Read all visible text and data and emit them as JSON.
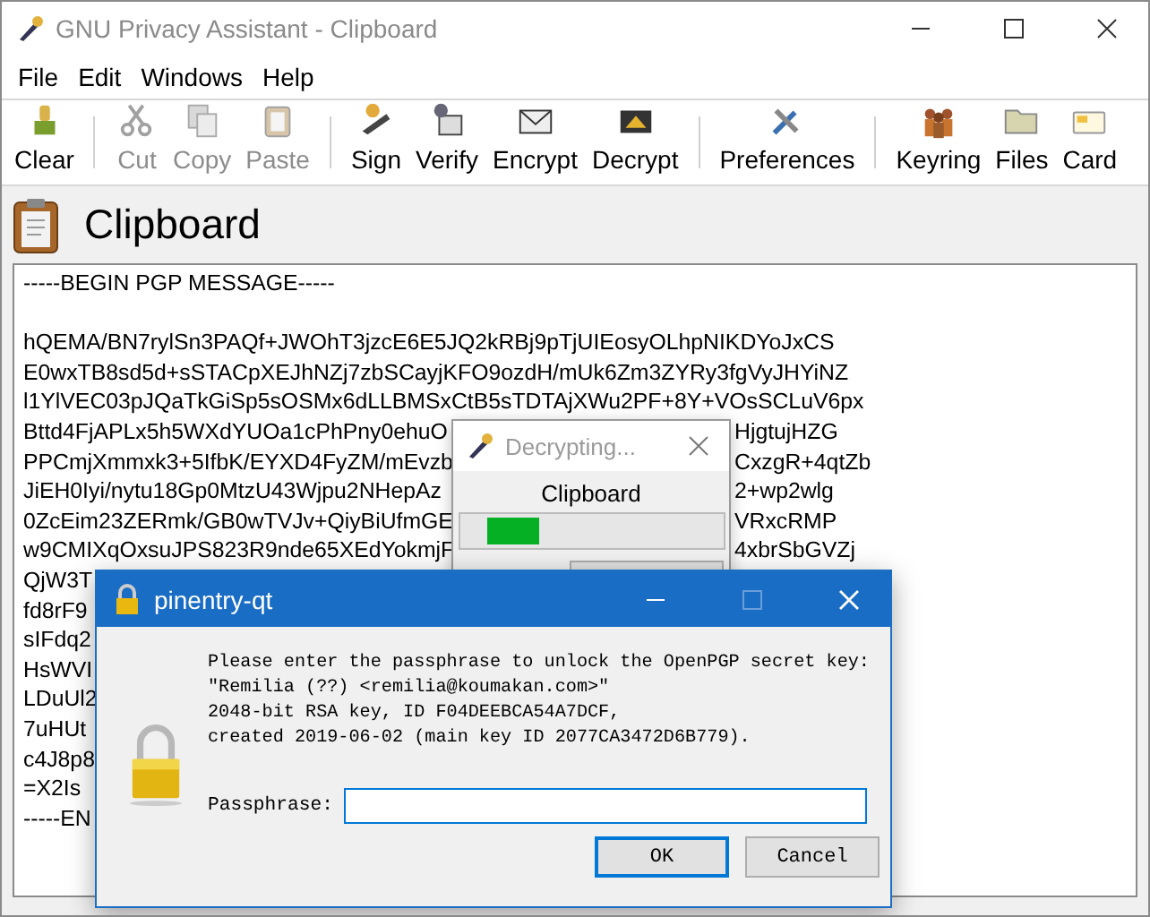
{
  "window": {
    "title": "GNU Privacy Assistant - Clipboard",
    "active": false
  },
  "menu": [
    {
      "label": "File"
    },
    {
      "label": "Edit"
    },
    {
      "label": "Windows"
    },
    {
      "label": "Help"
    }
  ],
  "toolbar": [
    [
      {
        "label": "Clear",
        "disabled": false
      }
    ],
    [
      {
        "label": "Cut",
        "disabled": true
      },
      {
        "label": "Copy",
        "disabled": true
      },
      {
        "label": "Paste",
        "disabled": true
      }
    ],
    [
      {
        "label": "Sign",
        "disabled": false
      },
      {
        "label": "Verify",
        "disabled": false
      },
      {
        "label": "Encrypt",
        "disabled": false
      },
      {
        "label": "Decrypt",
        "disabled": false
      }
    ],
    [
      {
        "label": "Preferences",
        "disabled": false
      }
    ],
    [
      {
        "label": "Keyring",
        "disabled": false
      },
      {
        "label": "Files",
        "disabled": false
      },
      {
        "label": "Card",
        "disabled": false
      }
    ]
  ],
  "header": {
    "title": "Clipboard"
  },
  "message_lines": [
    {
      "left": "-----BEGIN PGP MESSAGE-----"
    },
    {
      "kind": "blank"
    },
    {
      "left": "hQEMA/BN7rylSn3PAQf+JWOhT3jzcE6E5JQ2kRBj9pTjUIEosyOLhpNIKDYoJxCS"
    },
    {
      "left": "E0wxTB8sd5d+sSTACpXEJhNZj7zbSCayjKFO9ozdH/mUk6Zm3ZYRy3fgVyJHYiNZ"
    },
    {
      "left": "l1YlVEC03pJQaTkGiSp5sOSMx6dLLBMSxCtB5sTDTAjXWu2PF+8Y+VOsSCLuV6px"
    },
    {
      "left": "Bttd4FjAPLx5h5WXdYUOa1cPhPny0ehuO",
      "right": "HjgtujHZG"
    },
    {
      "left": "PPCmjXmmxk3+5IfbK/EYXD4FyZM/mEvzb",
      "right": "CxzgR+4qtZb"
    },
    {
      "left": "JiEH0Iyi/nytu18Gp0MtzU43Wjpu2NHepAz",
      "right": "2+wp2wlg"
    },
    {
      "left": "0ZcEim23ZERmk/GB0wTVJv+QiyBiUfmGE",
      "right": "VRxcRMP"
    },
    {
      "left": "w9CMIXqOxsuJPS823R9nde65XEdYokmjF",
      "right": "4xbrSbGVZj"
    },
    {
      "left": "QjW3T"
    },
    {
      "left": "fd8rF9"
    },
    {
      "left": "sIFdq2"
    },
    {
      "left": "HsWVI"
    },
    {
      "left": "LDuUl2"
    },
    {
      "left": "7uHUt"
    },
    {
      "left": "c4J8p8"
    },
    {
      "left": "=X2Is"
    },
    {
      "left": "-----EN"
    }
  ],
  "progress_dialog": {
    "title": "Decrypting...",
    "label": "Clipboard",
    "level": 0.2
  },
  "pinentry": {
    "title": "pinentry-qt",
    "message": [
      "Please enter the passphrase to unlock the OpenPGP secret key:",
      "\"Remilia (??) <remilia@koumakan.com>\"",
      "2048-bit RSA key, ID F04DEEBCA54A7DCF,",
      "created 2019-06-02 (main key ID 2077CA3472D6B779)."
    ],
    "field_label": "Passphrase:",
    "buttons": [
      {
        "label": "OK",
        "selected": true
      },
      {
        "label": "Cancel",
        "selected": false
      }
    ]
  }
}
